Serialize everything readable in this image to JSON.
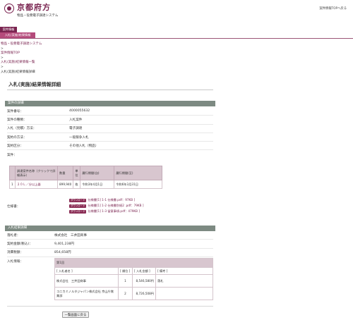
{
  "header": {
    "logo_text": "京都府方",
    "system_name": "物品・役務電子調達システム",
    "top_link": "案件情報TOPへ戻る"
  },
  "nav": {
    "tab1": "案件情報",
    "tab2": "入札(実施)結果情報"
  },
  "breadcrumb": {
    "item1": "物品・役務電子調達システム",
    "sep1": ">",
    "item2": "案件情報TOP",
    "sep2": ">",
    "item3": "入札(実施)結果情報一覧",
    "sep3": ">",
    "current": "入札(実施)結果情報詳細"
  },
  "page": {
    "title": "入札(実施)結果情報詳細"
  },
  "case_section": {
    "heading": "案件の詳細",
    "rows": [
      {
        "label": "案件番号：",
        "value": "4000055632"
      },
      {
        "label": "案件の種類：",
        "value": "入札案件"
      },
      {
        "label": "入札（見積）方法：",
        "value": "電子調達"
      },
      {
        "label": "契約の方法：",
        "value": "一般競争入札"
      },
      {
        "label": "契約区分：",
        "value": "その他入札（物品）"
      },
      {
        "label": "案件：",
        "value": ""
      }
    ]
  },
  "items_table": {
    "headers": [
      "",
      "調達案件名称（クリックで詳細表示）",
      "数量",
      "単位",
      "履行期間(自)",
      "履行期間(至)"
    ],
    "rows": [
      [
        "1",
        "２０Ｌ／分以上器",
        "899,940",
        "枚",
        "令和3年4月1日",
        "令和6年3月31日"
      ]
    ]
  },
  "specs": {
    "label": "仕様書：",
    "badge": "ダウンロード",
    "files": [
      "仕様書[1] 1-1 仕様書.pdf：97KB ]",
      "仕様書[1] 1-2 仕様書別紙2 .pdf：79KB ]",
      "仕様書[1] 1-3 留意事項.pdf：479KB ]"
    ]
  },
  "result_section": {
    "heading": "入札結果詳細",
    "rows": [
      {
        "label": "落札者：",
        "value": "株式会社　三井田商事"
      },
      {
        "label": "契約金額(税込)：",
        "value": "9,401,238円"
      },
      {
        "label": "消費税額：",
        "value": "854,658円"
      },
      {
        "label": "入札情報：",
        "value": ""
      }
    ]
  },
  "bids_table": {
    "round": "第1回",
    "headers": [
      "[ 入札者名 ]",
      "[ 順位 ]",
      "[ 入札金額 ]",
      "[ 備考 ]"
    ],
    "rows": [
      [
        "株式会社　三井田商事",
        "1",
        "8,546,580円",
        "落札"
      ],
      [
        "コニカミノルタジャパン株式会社 京山庁賞業部",
        "2",
        "8,726,508円",
        ""
      ]
    ]
  },
  "back_button": "一覧画面に戻る"
}
